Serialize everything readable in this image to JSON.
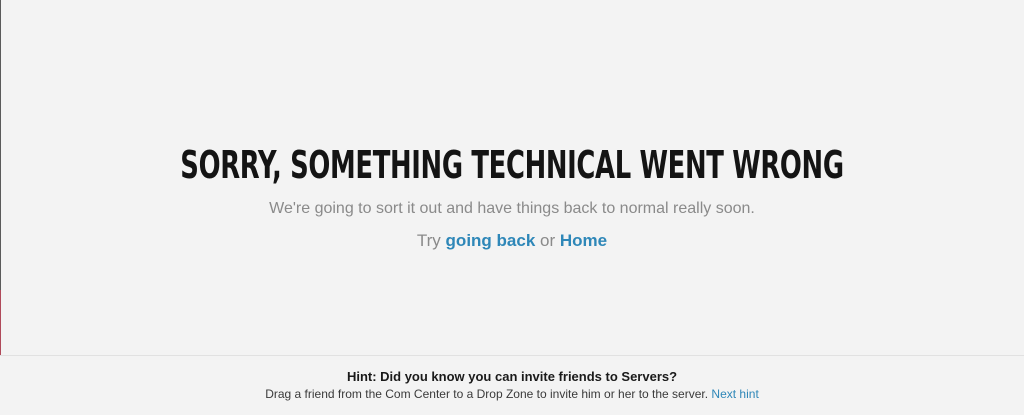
{
  "error": {
    "title": "Sorry, something technical went wrong",
    "subtitle": "We're going to sort it out and have things back to normal really soon.",
    "try_prefix": "Try",
    "going_back_link": "going back",
    "or_text": "or",
    "home_link": "Home"
  },
  "hint": {
    "title": "Hint: Did you know you can invite friends to Servers?",
    "text": "Drag a friend from the Com Center to a Drop Zone to invite him or her to the server.",
    "next_link": "Next hint"
  },
  "colors": {
    "background": "#f3f3f3",
    "link": "#2e87b8",
    "title": "#141414",
    "muted_text": "#8a8a8a"
  }
}
